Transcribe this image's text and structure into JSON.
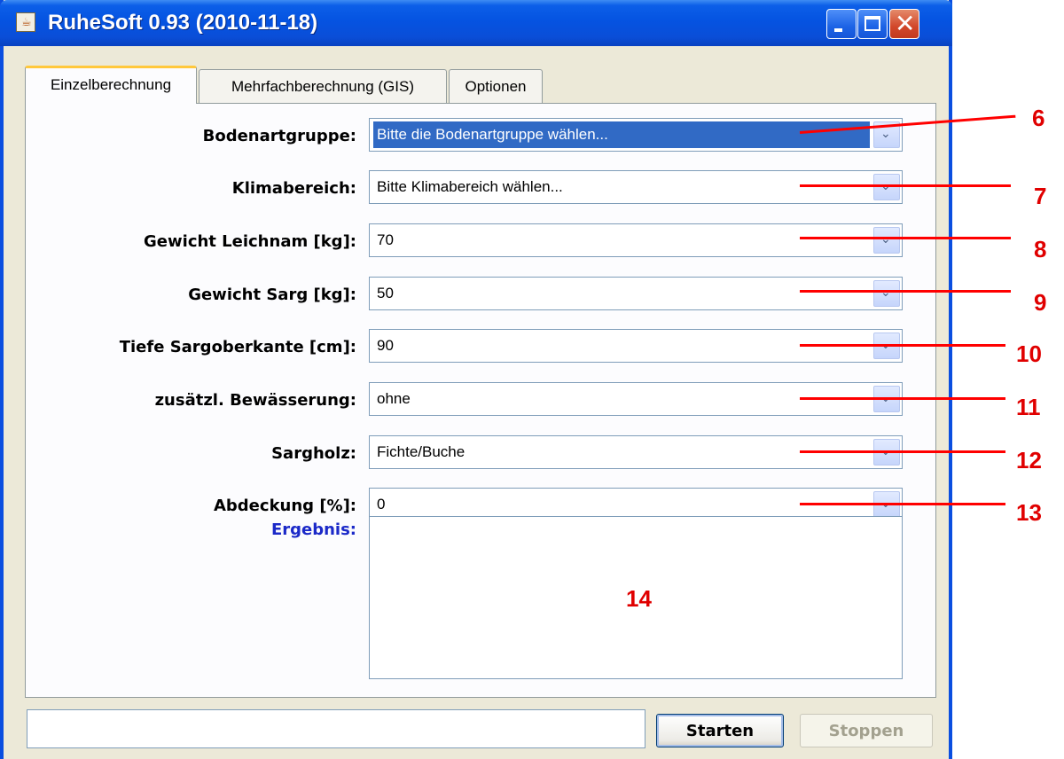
{
  "window": {
    "title": "RuheSoft 0.93 (2010-11-18)"
  },
  "tabs": [
    {
      "label": "Einzelberechnung",
      "active": true
    },
    {
      "label": "Mehrfachberechnung (GIS)",
      "active": false
    },
    {
      "label": "Optionen",
      "active": false
    }
  ],
  "form": {
    "fields": [
      {
        "label": "Bodenartgruppe:",
        "value": "Bitte die Bodenartgruppe wählen..."
      },
      {
        "label": "Klimabereich:",
        "value": "Bitte Klimabereich wählen..."
      },
      {
        "label": "Gewicht Leichnam [kg]:",
        "value": "70"
      },
      {
        "label": "Gewicht Sarg [kg]:",
        "value": "50"
      },
      {
        "label": "Tiefe Sargoberkante [cm]:",
        "value": "90"
      },
      {
        "label": "zusätzl. Bewässerung:",
        "value": "ohne"
      },
      {
        "label": "Sargholz:",
        "value": "Fichte/Buche"
      },
      {
        "label": "Abdeckung [%]:",
        "value": "0"
      }
    ],
    "result_label": "Ergebnis:",
    "result_value": ""
  },
  "footer": {
    "status_value": "",
    "start_label": "Starten",
    "stop_label": "Stoppen"
  },
  "annotations": {
    "numbers": [
      "6",
      "7",
      "8",
      "9",
      "10",
      "11",
      "12",
      "13",
      "14"
    ],
    "color": "#e00000"
  },
  "colors": {
    "titlebar": "#0553e1",
    "selection": "#316ac5",
    "result_label": "#1b29c8",
    "active_tab_accent": "#ffc83c"
  }
}
